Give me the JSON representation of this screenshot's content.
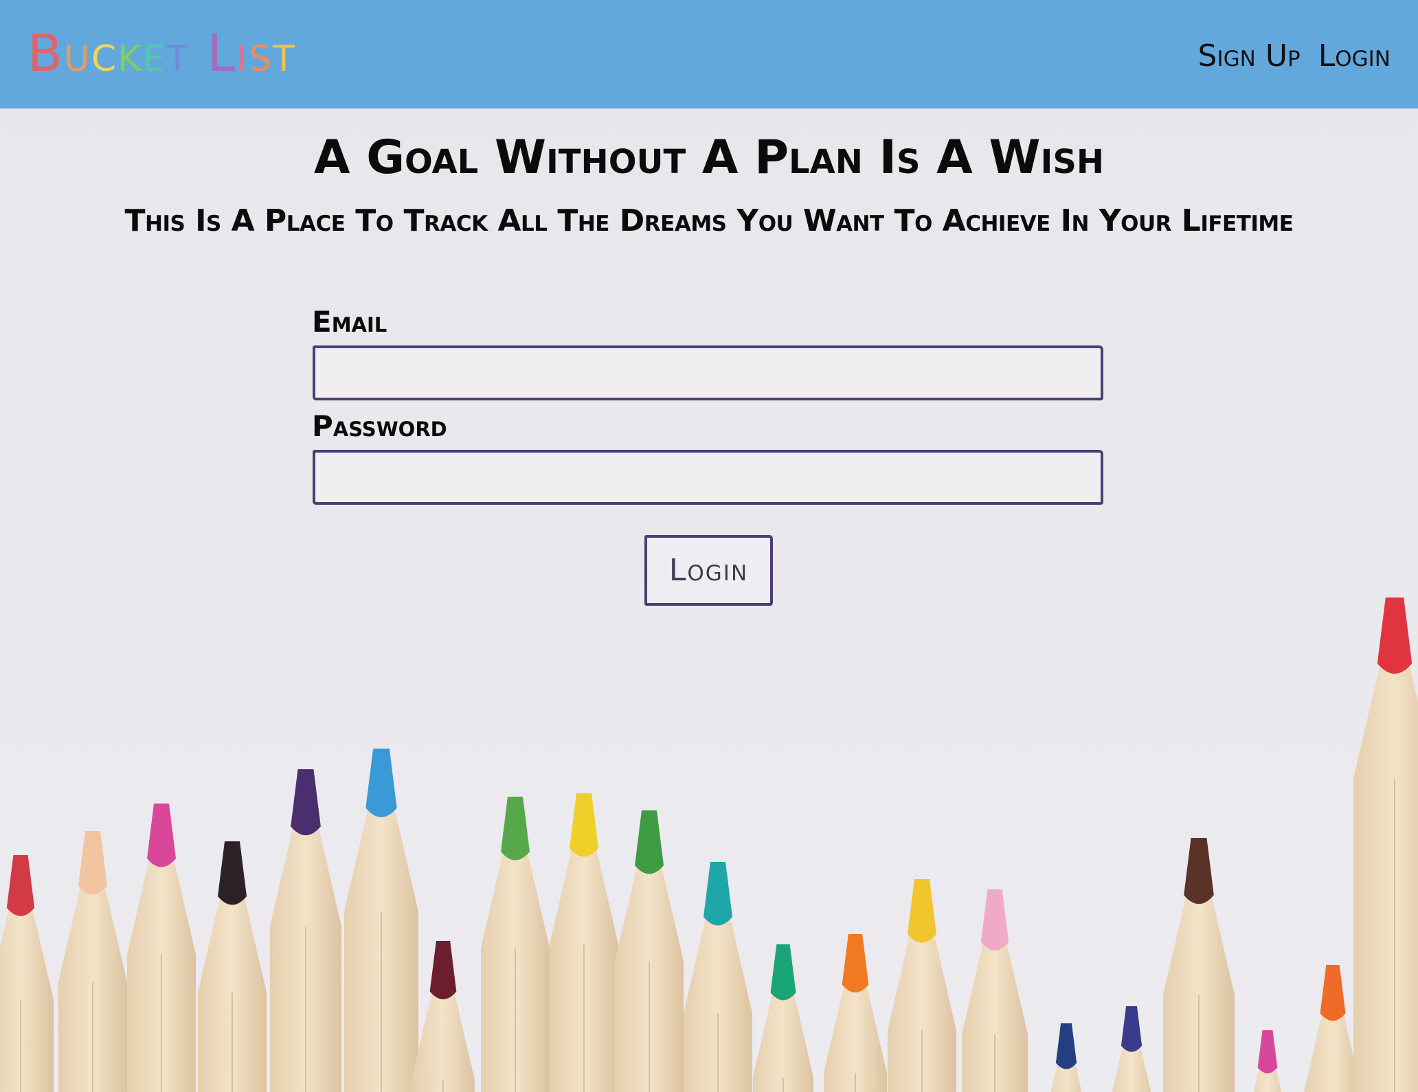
{
  "navbar": {
    "brand": {
      "text": "Bucket List",
      "letters": [
        {
          "char": "B",
          "color": "#e0636a"
        },
        {
          "char": "u",
          "color": "#ee9a55"
        },
        {
          "char": "c",
          "color": "#ecd65c"
        },
        {
          "char": "k",
          "color": "#7ed05a"
        },
        {
          "char": "e",
          "color": "#52c8a8"
        },
        {
          "char": "t",
          "color": "#6c8ed8"
        },
        {
          "char": " ",
          "color": "#000000"
        },
        {
          "char": "L",
          "color": "#a46cbc"
        },
        {
          "char": "i",
          "color": "#ea6e8e"
        },
        {
          "char": "s",
          "color": "#f08c55"
        },
        {
          "char": "t",
          "color": "#f0c252"
        }
      ]
    },
    "links": [
      {
        "label": "Sign Up"
      },
      {
        "label": "Login"
      }
    ],
    "background": "#62a8dd"
  },
  "hero": {
    "title": "A Goal Without A Plan Is A Wish",
    "subtitle": "This Is A Place To Track All The Dreams You Want To Achieve In Your Lifetime"
  },
  "form": {
    "email_label": "Email",
    "email_value": "",
    "password_label": "Password",
    "password_value": "",
    "submit_label": "Login",
    "border_color": "#4a3f74"
  },
  "background_image": {
    "pencil_tip_colors": [
      "#d23a45",
      "#f2c4a0",
      "#d8479a",
      "#2a2226",
      "#4b2e6e",
      "#3a9ad8",
      "#6b1f2c",
      "#56a84a",
      "#f0d028",
      "#3f9a44",
      "#1fa6a8",
      "#1aa577",
      "#f07a22",
      "#f0c52e",
      "#f1a9c8",
      "#5a3328",
      "#233f82",
      "#3b3b8e",
      "#d8489a",
      "#f06a28",
      "#e0353e"
    ]
  }
}
